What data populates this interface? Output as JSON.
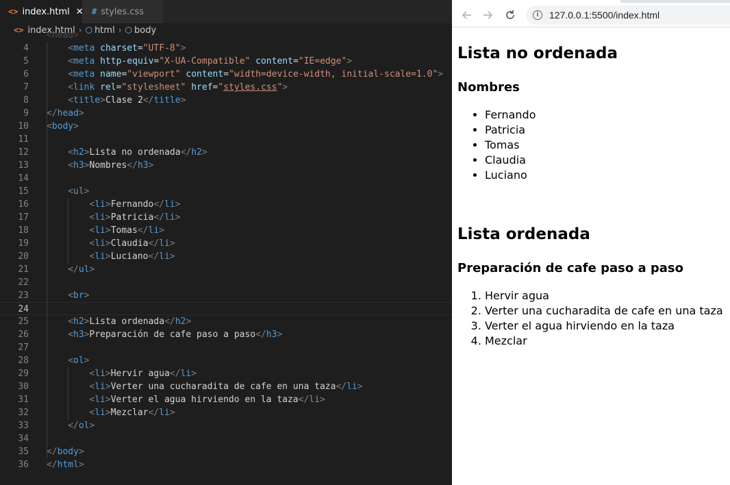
{
  "editor": {
    "tabs": [
      {
        "label": "index.html",
        "icon": "html-file-icon"
      },
      {
        "label": "styles.css",
        "icon": "css-file-icon"
      }
    ],
    "breadcrumb": [
      "index.html",
      "html",
      "body"
    ],
    "ghost_line": "<head>",
    "lines": [
      {
        "n": "4",
        "indent": 4,
        "html": "<span class='p'>&lt;</span><span class='t'>meta</span> <span class='a'>charset</span>=<span class='s'>\"UTF-8\"</span><span class='p'>&gt;</span>"
      },
      {
        "n": "5",
        "indent": 4,
        "html": "<span class='p'>&lt;</span><span class='t'>meta</span> <span class='a'>http-equiv</span>=<span class='s'>\"X-UA-Compatible\"</span> <span class='a'>content</span>=<span class='s'>\"IE=edge\"</span><span class='p'>&gt;</span>"
      },
      {
        "n": "6",
        "indent": 4,
        "html": "<span class='p'>&lt;</span><span class='t'>meta</span> <span class='a'>name</span>=<span class='s'>\"viewport\"</span> <span class='a'>content</span>=<span class='s'>\"width=device-width, initial-scale=1.0\"</span><span class='p'>&gt;</span>"
      },
      {
        "n": "7",
        "indent": 4,
        "html": "<span class='p'>&lt;</span><span class='t'>link</span> <span class='a'>rel</span>=<span class='s'>\"stylesheet\"</span> <span class='a'>href</span>=<span class='s'>\"</span><span class='u'>styles.css</span><span class='s'>\"</span><span class='p'>&gt;</span>"
      },
      {
        "n": "8",
        "indent": 4,
        "html": "<span class='p'>&lt;</span><span class='t'>title</span><span class='p'>&gt;</span>Clase 2<span class='p'>&lt;/</span><span class='t'>title</span><span class='p'>&gt;</span>"
      },
      {
        "n": "9",
        "indent": 0,
        "html": "<span class='p'>&lt;/</span><span class='t'>head</span><span class='p'>&gt;</span>"
      },
      {
        "n": "10",
        "indent": 0,
        "html": "<span class='p'>&lt;</span><span class='t'>body</span><span class='p'>&gt;</span>"
      },
      {
        "n": "11",
        "indent": 0,
        "html": ""
      },
      {
        "n": "12",
        "indent": 4,
        "html": "<span class='p'>&lt;</span><span class='t'>h2</span><span class='p'>&gt;</span>Lista no ordenada<span class='p'>&lt;/</span><span class='t'>h2</span><span class='p'>&gt;</span>"
      },
      {
        "n": "13",
        "indent": 4,
        "html": "<span class='p'>&lt;</span><span class='t'>h3</span><span class='p'>&gt;</span>Nombres<span class='p'>&lt;/</span><span class='t'>h3</span><span class='p'>&gt;</span>"
      },
      {
        "n": "14",
        "indent": 0,
        "html": ""
      },
      {
        "n": "15",
        "indent": 4,
        "html": "<span class='p'>&lt;</span><span class='t'>ul</span><span class='p'>&gt;</span>"
      },
      {
        "n": "16",
        "indent": 8,
        "html": "<span class='p'>&lt;</span><span class='t'>li</span><span class='p'>&gt;</span>Fernando<span class='p'>&lt;/</span><span class='t'>li</span><span class='p'>&gt;</span>"
      },
      {
        "n": "17",
        "indent": 8,
        "html": "<span class='p'>&lt;</span><span class='t'>li</span><span class='p'>&gt;</span>Patricia<span class='p'>&lt;/</span><span class='t'>li</span><span class='p'>&gt;</span>"
      },
      {
        "n": "18",
        "indent": 8,
        "html": "<span class='p'>&lt;</span><span class='t'>li</span><span class='p'>&gt;</span>Tomas<span class='p'>&lt;/</span><span class='t'>li</span><span class='p'>&gt;</span>"
      },
      {
        "n": "19",
        "indent": 8,
        "html": "<span class='p'>&lt;</span><span class='t'>li</span><span class='p'>&gt;</span>Claudia<span class='p'>&lt;/</span><span class='t'>li</span><span class='p'>&gt;</span>"
      },
      {
        "n": "20",
        "indent": 8,
        "html": "<span class='p'>&lt;</span><span class='t'>li</span><span class='p'>&gt;</span>Luciano<span class='p'>&lt;/</span><span class='t'>li</span><span class='p'>&gt;</span>"
      },
      {
        "n": "21",
        "indent": 4,
        "html": "<span class='p'>&lt;/</span><span class='t'>ul</span><span class='p'>&gt;</span>"
      },
      {
        "n": "22",
        "indent": 0,
        "html": ""
      },
      {
        "n": "23",
        "indent": 4,
        "html": "<span class='p'>&lt;</span><span class='t'>br</span><span class='p'>&gt;</span>"
      },
      {
        "n": "24",
        "indent": 0,
        "html": "",
        "current": true
      },
      {
        "n": "25",
        "indent": 4,
        "html": "<span class='p'>&lt;</span><span class='t'>h2</span><span class='p'>&gt;</span>Lista ordenada<span class='p'>&lt;/</span><span class='t'>h2</span><span class='p'>&gt;</span>"
      },
      {
        "n": "26",
        "indent": 4,
        "html": "<span class='p'>&lt;</span><span class='t'>h3</span><span class='p'>&gt;</span>Preparación de cafe paso a paso<span class='p'>&lt;/</span><span class='t'>h3</span><span class='p'>&gt;</span>"
      },
      {
        "n": "27",
        "indent": 0,
        "html": ""
      },
      {
        "n": "28",
        "indent": 4,
        "html": "<span class='p'>&lt;</span><span class='t'>ol</span><span class='p'>&gt;</span>"
      },
      {
        "n": "29",
        "indent": 8,
        "html": "<span class='p'>&lt;</span><span class='t'>li</span><span class='p'>&gt;</span>Hervir agua<span class='p'>&lt;/</span><span class='t'>li</span><span class='p'>&gt;</span>"
      },
      {
        "n": "30",
        "indent": 8,
        "html": "<span class='p'>&lt;</span><span class='t'>li</span><span class='p'>&gt;</span>Verter una cucharadita de cafe en una taza<span class='p'>&lt;/</span><span class='t'>li</span><span class='p'>&gt;</span>"
      },
      {
        "n": "31",
        "indent": 8,
        "html": "<span class='p'>&lt;</span><span class='t'>li</span><span class='p'>&gt;</span>Verter el agua hirviendo en la taza<span class='p'>&lt;/</span><span class='t'>li</span><span class='p'>&gt;</span>"
      },
      {
        "n": "32",
        "indent": 8,
        "html": "<span class='p'>&lt;</span><span class='t'>li</span><span class='p'>&gt;</span>Mezclar<span class='p'>&lt;/</span><span class='t'>li</span><span class='p'>&gt;</span>"
      },
      {
        "n": "33",
        "indent": 4,
        "html": "<span class='p'>&lt;/</span><span class='t'>ol</span><span class='p'>&gt;</span>"
      },
      {
        "n": "34",
        "indent": 0,
        "html": ""
      },
      {
        "n": "35",
        "indent": 0,
        "html": "<span class='p'>&lt;/</span><span class='t'>body</span><span class='p'>&gt;</span>"
      },
      {
        "n": "36",
        "indent": 0,
        "html": "<span class='p'>&lt;/</span><span class='t'>html</span><span class='p'>&gt;</span>"
      }
    ]
  },
  "browser": {
    "url": "127.0.0.1:5500/index.html",
    "page": {
      "h2_unordered": "Lista no ordenada",
      "h3_unordered": "Nombres",
      "unordered_items": [
        "Fernando",
        "Patricia",
        "Tomas",
        "Claudia",
        "Luciano"
      ],
      "h2_ordered": "Lista ordenada",
      "h3_ordered": "Preparación de cafe paso a paso",
      "ordered_items": [
        "Hervir agua",
        "Verter una cucharadita de cafe en una taza",
        "Verter el agua hirviendo en la taza",
        "Mezclar"
      ]
    }
  },
  "colors": {
    "editor_bg": "#1e1e1e",
    "tag": "#569cd6",
    "attr": "#9cdcfe",
    "string": "#ce9178",
    "punct": "#808080"
  }
}
